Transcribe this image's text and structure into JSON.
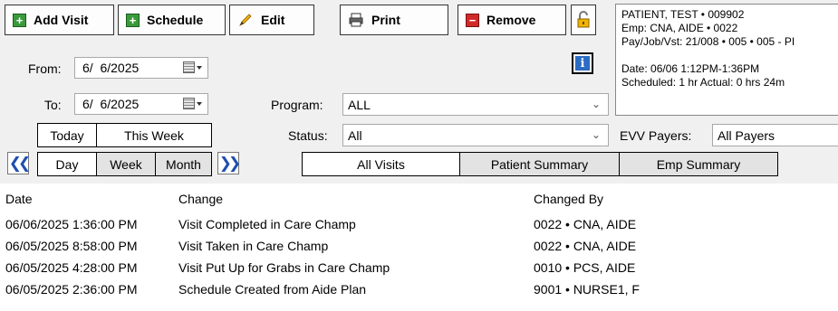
{
  "toolbar": {
    "add_visit": "Add Visit",
    "schedule": "Schedule",
    "edit": "Edit",
    "print": "Print",
    "remove": "Remove"
  },
  "info": {
    "line1": "PATIENT, TEST  • 009902",
    "line2": "Emp: CNA, AIDE • 0022",
    "line3": "Pay/Job/Vst: 21/008 • 005 • 005 - PI",
    "line4": "Date: 06/06 1:12PM-1:36PM",
    "line5": "Scheduled: 1 hr  Actual: 0 hrs 24m"
  },
  "filters": {
    "from_label": "From:",
    "from_value": "6/  6/2025",
    "to_label": "To:",
    "to_value": "6/  6/2025",
    "program_label": "Program:",
    "program_value": "ALL",
    "status_label": "Status:",
    "status_value": "All",
    "evv_label": "EVV Payers:",
    "evv_value": "All Payers"
  },
  "range": {
    "today": "Today",
    "this_week": "This Week",
    "day": "Day",
    "week": "Week",
    "month": "Month"
  },
  "tabs": [
    {
      "label": "All Visits",
      "active": true
    },
    {
      "label": "Patient Summary",
      "active": false
    },
    {
      "label": "Emp Summary",
      "active": false
    }
  ],
  "table": {
    "headers": [
      "Date",
      "Change",
      "Changed By"
    ],
    "rows": [
      [
        "06/06/2025 1:36:00 PM",
        "Visit Completed in Care Champ",
        "0022 • CNA, AIDE"
      ],
      [
        "06/05/2025 8:58:00 PM",
        "Visit Taken in Care Champ",
        "0022 • CNA, AIDE"
      ],
      [
        "06/05/2025 4:28:00 PM",
        "Visit Put Up for Grabs in Care Champ",
        "0010 • PCS, AIDE"
      ],
      [
        "06/05/2025 2:36:00 PM",
        "Schedule Created from Aide Plan",
        "9001 • NURSE1, F"
      ]
    ]
  }
}
